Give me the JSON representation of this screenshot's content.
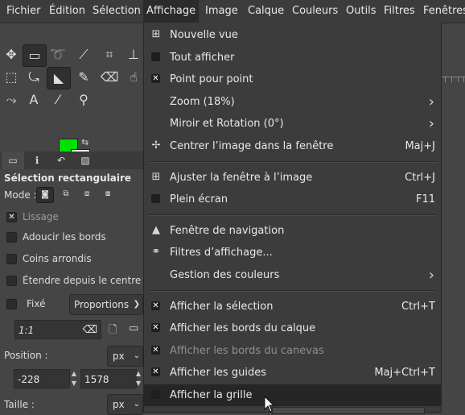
{
  "menubar": {
    "items": [
      "Fichier",
      "Édition",
      "Sélection",
      "Affichage",
      "Image",
      "Calque",
      "Couleurs",
      "Outils",
      "Filtres",
      "Fenêtres"
    ],
    "active_index": 3
  },
  "toolbox": {
    "tools": [
      {
        "icon": "move-icon",
        "glyph": "✥"
      },
      {
        "icon": "rect-select-icon",
        "glyph": "▭"
      },
      {
        "icon": "lasso-icon",
        "glyph": "➰"
      },
      {
        "icon": "fuzzy-select-icon",
        "glyph": "⟋"
      },
      {
        "icon": "crop-icon",
        "glyph": "⌗"
      },
      {
        "icon": "transform-icon",
        "glyph": "⬚"
      },
      {
        "icon": "warp-icon",
        "glyph": "⤿"
      },
      {
        "icon": "bucket-fill-icon",
        "glyph": "◣"
      },
      {
        "icon": "paintbrush-icon",
        "glyph": "✎"
      },
      {
        "icon": "eraser-icon",
        "glyph": "⌫"
      },
      {
        "icon": "clone-icon",
        "glyph": "⊥"
      },
      {
        "icon": "smudge-icon",
        "glyph": "☝"
      },
      {
        "icon": "paths-icon",
        "glyph": "⤳"
      },
      {
        "icon": "text-icon",
        "glyph": "A"
      },
      {
        "icon": "color-picker-icon",
        "glyph": "⁄"
      },
      {
        "icon": "zoom-icon",
        "glyph": "⚲"
      }
    ],
    "fg_color": "#00e000",
    "bg_color": "#ffffff"
  },
  "tool_options": {
    "title": "Sélection rectangulaire",
    "mode_label": "Mode :",
    "lissage": "Lissage",
    "adoucir": "Adoucir les bords",
    "coins": "Coins arrondis",
    "etendre": "Étendre depuis le centre",
    "fixe": "Fixé",
    "proportions": "Proportions",
    "ratio_value": "1:1",
    "position_label": "Position :",
    "position_unit": "px",
    "position_x": "-228",
    "position_y": "1578",
    "taille_label": "Taille :",
    "taille_unit": "px"
  },
  "view_menu": {
    "items": [
      {
        "label": "Nouvelle vue",
        "icon": "new-view-icon",
        "glyph": "⊞",
        "shortcut": ""
      },
      {
        "label": "Tout afficher",
        "icon": "checkbox-empty-icon",
        "check": "empty",
        "shortcut": ""
      },
      {
        "label": "Point pour point",
        "icon": "checkbox-checked-icon",
        "check": "checked",
        "shortcut": ""
      },
      {
        "label": "Zoom (18%)",
        "submenu": true
      },
      {
        "label": "Miroir et Rotation (0°)",
        "submenu": true
      },
      {
        "label": "Centrer l’image dans la fenêtre",
        "icon": "center-icon",
        "glyph": "✢",
        "shortcut": "Maj+J"
      },
      {
        "separator": true
      },
      {
        "label": "Ajuster la fenêtre à l’image",
        "icon": "fit-window-icon",
        "glyph": "⊞",
        "shortcut": "Ctrl+J"
      },
      {
        "label": "Plein écran",
        "icon": "checkbox-empty-icon",
        "check": "empty",
        "shortcut": "F11"
      },
      {
        "separator": true
      },
      {
        "label": "Fenêtre de navigation",
        "icon": "navigation-icon",
        "glyph": "▲",
        "shortcut": ""
      },
      {
        "label": "Filtres d’affichage...",
        "icon": "glasses-icon",
        "glyph": "⚭",
        "shortcut": ""
      },
      {
        "label": "Gestion des couleurs",
        "submenu": true
      },
      {
        "separator": true
      },
      {
        "label": "Afficher la sélection",
        "icon": "checkbox-checked-icon",
        "check": "checked",
        "shortcut": "Ctrl+T"
      },
      {
        "label": "Afficher les bords du calque",
        "icon": "checkbox-checked-icon",
        "check": "checked",
        "shortcut": ""
      },
      {
        "label": "Afficher les bords du canevas",
        "icon": "checkbox-checked-icon",
        "check": "checked",
        "disabled": true,
        "shortcut": ""
      },
      {
        "label": "Afficher les guides",
        "icon": "checkbox-checked-icon",
        "check": "checked",
        "shortcut": "Maj+Ctrl+T"
      },
      {
        "label": "Afficher la grille",
        "icon": "checkbox-empty-icon",
        "check": "empty",
        "highlighted": true,
        "shortcut": ""
      }
    ]
  }
}
